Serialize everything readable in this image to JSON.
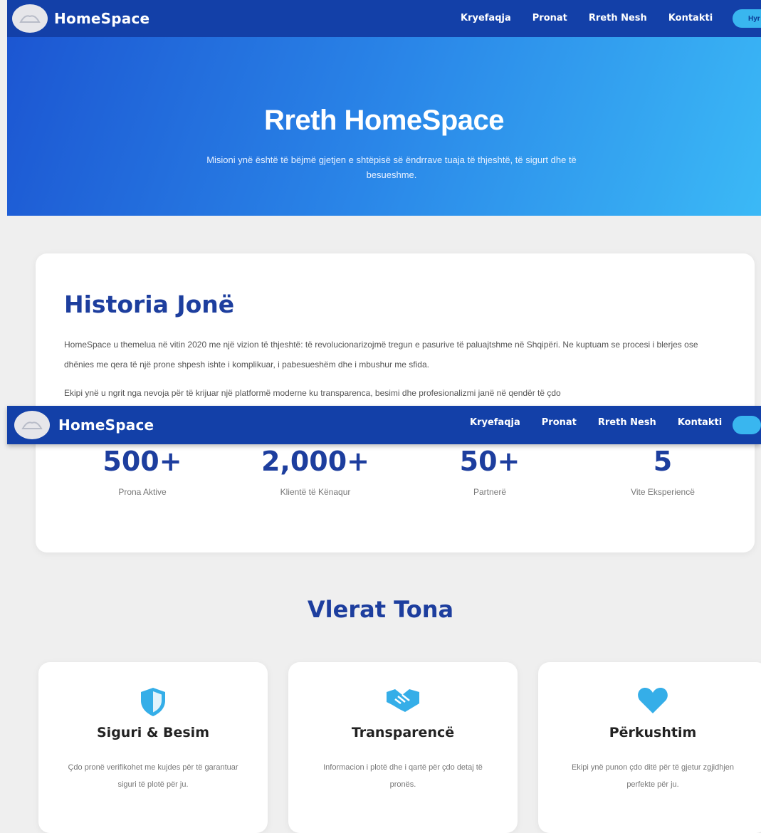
{
  "brand": {
    "name": "HomeSpace"
  },
  "nav": {
    "links": [
      "Kryefaqja",
      "Pronat",
      "Rreth Nesh",
      "Kontakti"
    ],
    "cta_label": "Hyr"
  },
  "hero": {
    "title": "Rreth HomeSpace",
    "subtitle": "Misioni ynë është të bëjmë gjetjen e shtëpisë së ëndrrave tuaja të thjeshtë, të sigurt dhe të besueshme."
  },
  "history": {
    "title": "Historia Jonë",
    "paragraph1": "HomeSpace u themelua në vitin 2020 me një vizion të thjeshtë: të revolucionarizojmë tregun e pasurive të paluajtshme në Shqipëri. Ne kuptuam se procesi i blerjes ose dhënies me qera të një prone shpesh ishte i komplikuar, i pabesueshëm dhe i mbushur me sfida.",
    "paragraph2": "Ekipi ynë u ngrit nga nevoja për të krijuar një platformë moderne ku transparenca, besimi dhe profesionalizmi janë në qendër të çdo"
  },
  "stats": [
    {
      "value": "500+",
      "label": "Prona Aktive"
    },
    {
      "value": "2,000+",
      "label": "Klientë të Kënaqur"
    },
    {
      "value": "50+",
      "label": "Partnerë"
    },
    {
      "value": "5",
      "label": "Vite Eksperiencë"
    }
  ],
  "values": {
    "title": "Vlerat Tona",
    "cards": [
      {
        "icon": "shield-icon",
        "title": "Siguri & Besim",
        "text": "Çdo pronë verifikohet me kujdes për të garantuar siguri të plotë për ju."
      },
      {
        "icon": "handshake-icon",
        "title": "Transparencë",
        "text": "Informacion i plotë dhe i qartë për çdo detaj të pronës."
      },
      {
        "icon": "heart-icon",
        "title": "Përkushtim",
        "text": "Ekipi ynë punon çdo ditë për të gjetur zgjidhjen perfekte për ju."
      }
    ]
  },
  "colors": {
    "nav": "#1340a8",
    "heading": "#1d3e9e",
    "accent": "#39b6ef",
    "background": "#efefef"
  }
}
